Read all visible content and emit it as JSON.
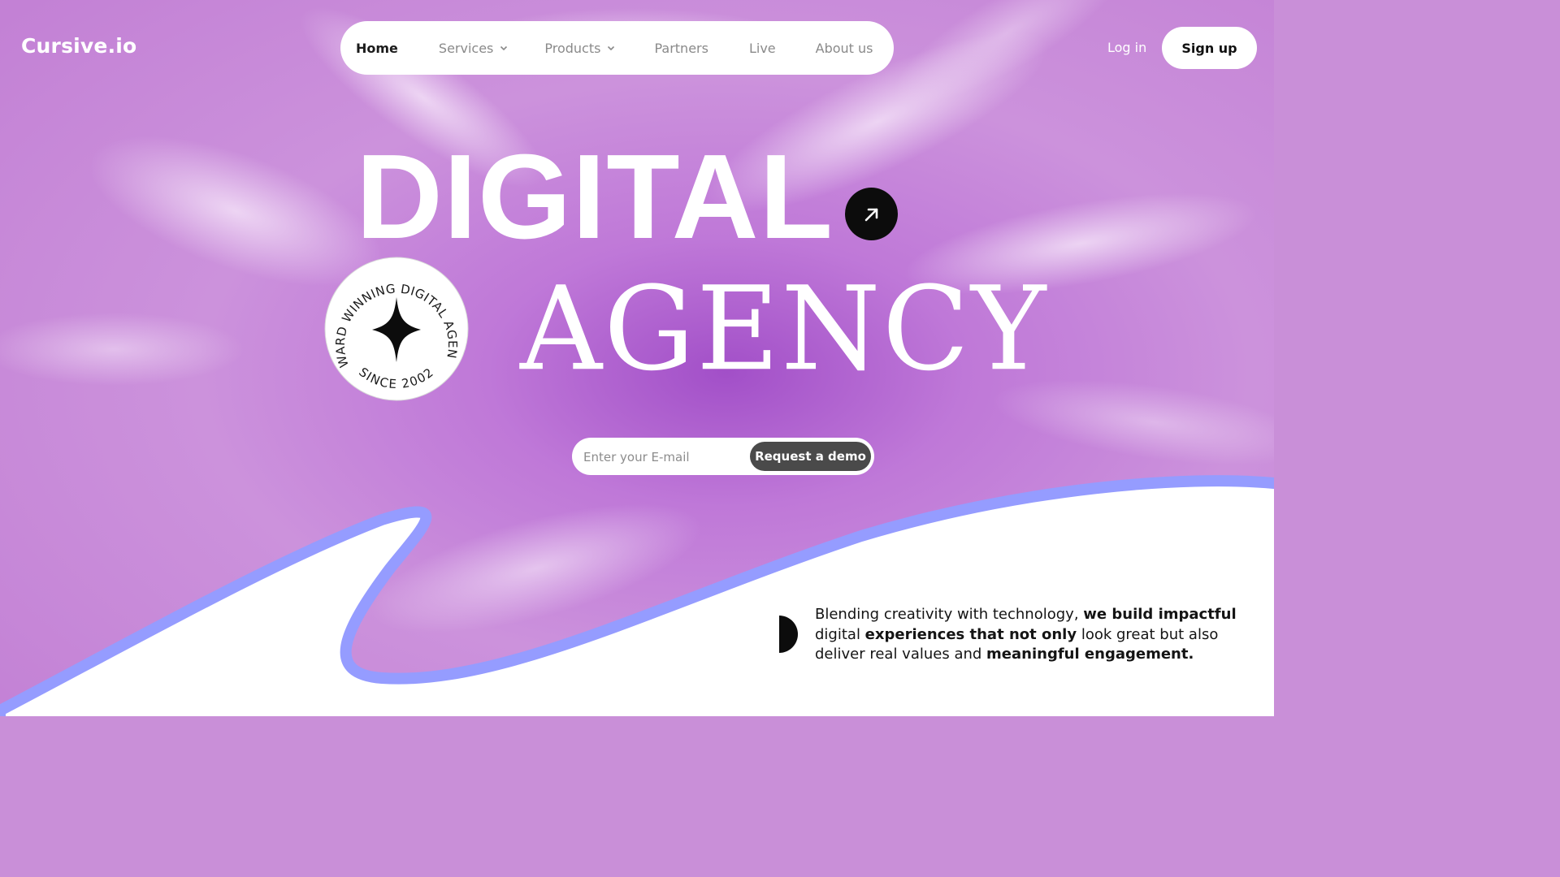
{
  "brand": {
    "logo": "Cursive.io"
  },
  "nav": {
    "items": [
      {
        "label": "Home",
        "active": true,
        "dropdown": false
      },
      {
        "label": "Services",
        "active": false,
        "dropdown": true
      },
      {
        "label": "Products",
        "active": false,
        "dropdown": true
      },
      {
        "label": "Partners",
        "active": false,
        "dropdown": false
      },
      {
        "label": "Live",
        "active": false,
        "dropdown": false
      },
      {
        "label": "About us",
        "active": false,
        "dropdown": false
      }
    ]
  },
  "auth": {
    "login": "Log in",
    "signup": "Sign up"
  },
  "hero": {
    "title_line1": "DIGITAL",
    "title_line2": "AGENCY",
    "badge_top": "AWARD WINNING DIGITAL AGENCY",
    "badge_bottom": "SINCE 2002",
    "arrow_icon": "arrow-up-right-icon"
  },
  "demo_form": {
    "placeholder": "Enter your E-mail",
    "button": "Request a demo"
  },
  "tagline": {
    "p1": "Blending creativity with technology, ",
    "b1": "we build impactful",
    "p2": " digital ",
    "b2": "experiences that not only",
    "p3": " look great but also deliver real values and ",
    "b3": "meaningful engagement."
  },
  "colors": {
    "background_purple": "#c98fd8",
    "wave_stroke": "#959cff",
    "dark": "#0c0c0c",
    "demo_button": "#4a4a4a"
  }
}
